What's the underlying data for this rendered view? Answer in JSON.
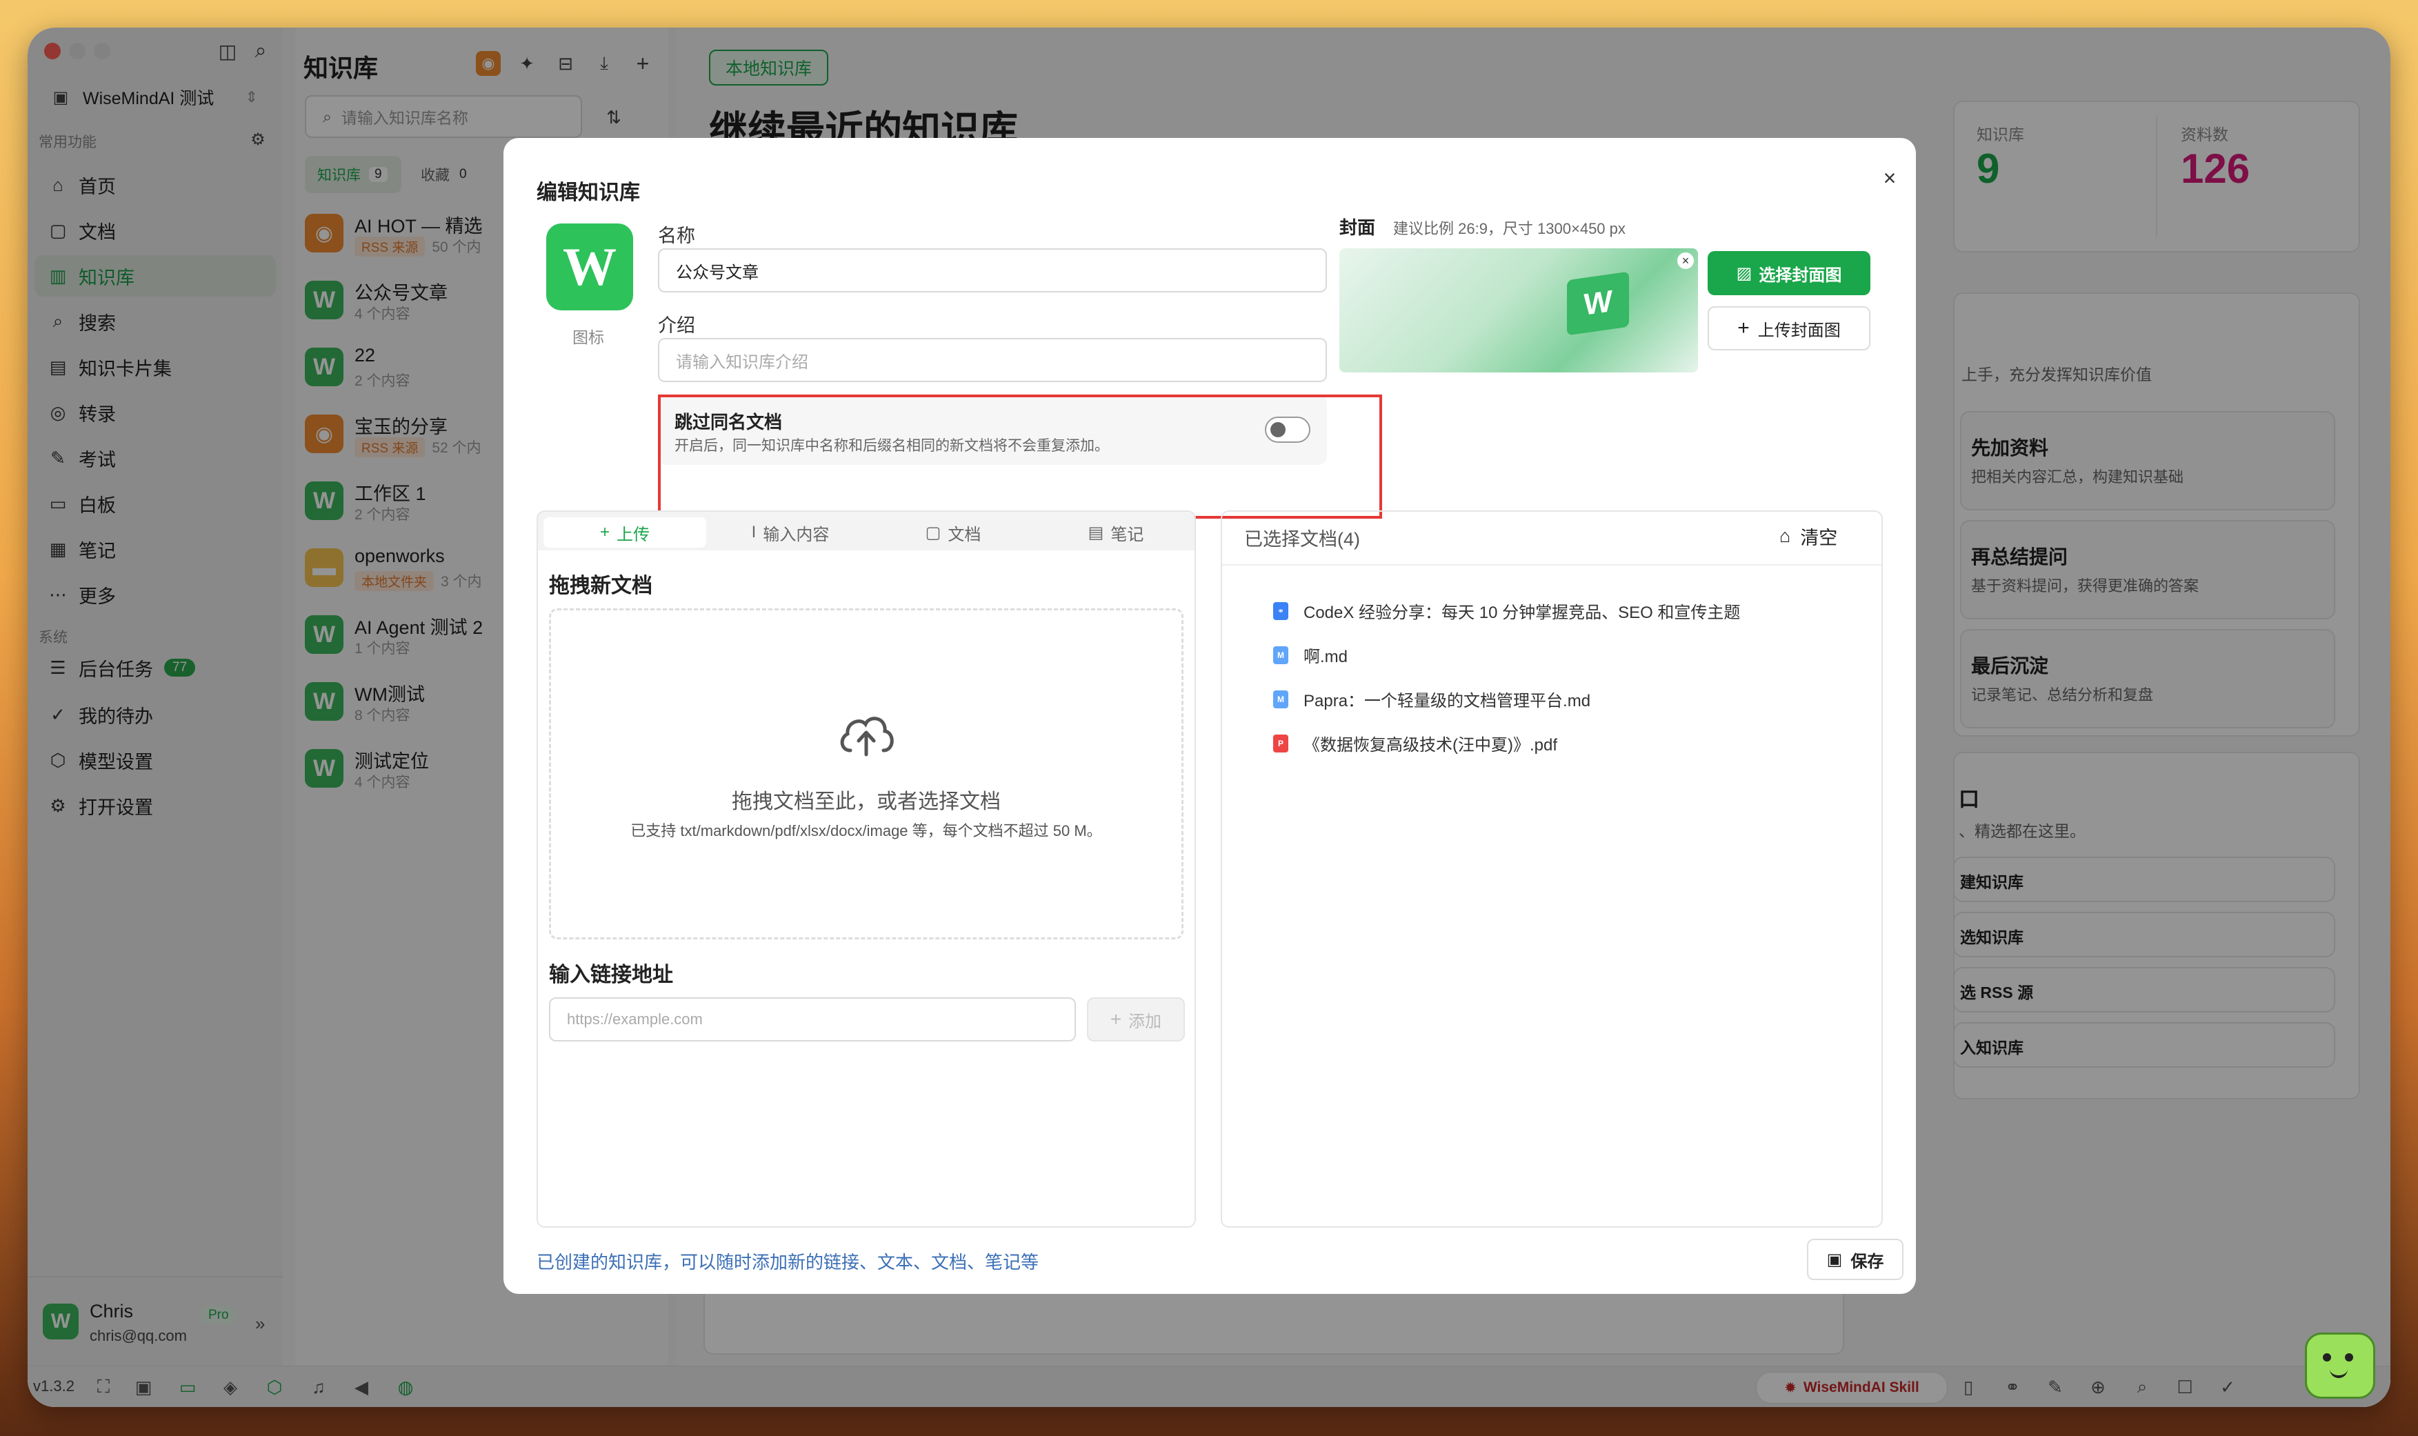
{
  "colors": {
    "accent": "#1aa64a",
    "rss": "#f08a30",
    "highlight": "#e53935",
    "number_pink": "#d81b7a"
  },
  "sidebar": {
    "workspace": "WiseMindAI 测试",
    "section_common": "常用功能",
    "items": [
      {
        "label": "首页",
        "icon": "home-icon",
        "glyph": "⌂"
      },
      {
        "label": "文档",
        "icon": "document-icon",
        "glyph": "▢"
      },
      {
        "label": "知识库",
        "icon": "book-icon",
        "glyph": "▥"
      },
      {
        "label": "搜索",
        "icon": "search-icon",
        "glyph": "⌕"
      },
      {
        "label": "知识卡片集",
        "icon": "cards-icon",
        "glyph": "▤"
      },
      {
        "label": "转录",
        "icon": "transcribe-icon",
        "glyph": "◎"
      },
      {
        "label": "考试",
        "icon": "exam-icon",
        "glyph": "✎"
      },
      {
        "label": "白板",
        "icon": "whiteboard-icon",
        "glyph": "▭"
      },
      {
        "label": "笔记",
        "icon": "notes-icon",
        "glyph": "▦"
      },
      {
        "label": "更多",
        "icon": "more-icon",
        "glyph": "⋯"
      }
    ],
    "section_system": "系统",
    "system_items": [
      {
        "label": "后台任务",
        "icon": "tasks-icon",
        "glyph": "☰",
        "badge": "77"
      },
      {
        "label": "我的待办",
        "icon": "check-circle-icon",
        "glyph": "✓"
      },
      {
        "label": "模型设置",
        "icon": "model-icon",
        "glyph": "⬡"
      },
      {
        "label": "打开设置",
        "icon": "gear-icon",
        "glyph": "⚙"
      }
    ],
    "user": {
      "name": "Chris",
      "email": "chris@qq.com",
      "plan": "Pro"
    }
  },
  "list": {
    "title": "知识库",
    "search_placeholder": "请输入知识库名称",
    "tab_kb": "知识库",
    "tab_kb_count": "9",
    "tab_fav": "收藏",
    "tab_fav_count": "0",
    "items": [
      {
        "name": "AI HOT — 精选",
        "tag": "RSS 来源",
        "sub": "50 个内",
        "logo": "rss"
      },
      {
        "name": "公众号文章",
        "tag": "",
        "sub": "4 个内容",
        "logo": "w"
      },
      {
        "name": "22",
        "tag": "",
        "sub": "2 个内容",
        "logo": "w"
      },
      {
        "name": "宝玉的分享",
        "tag": "RSS 来源",
        "sub": "52 个内",
        "logo": "rss"
      },
      {
        "name": "工作区 1",
        "tag": "",
        "sub": "2 个内容",
        "logo": "w"
      },
      {
        "name": "openworks",
        "tag": "本地文件夹",
        "sub": "3 个内",
        "logo": "folder"
      },
      {
        "name": "AI Agent 测试 2",
        "tag": "",
        "sub": "1 个内容",
        "logo": "w"
      },
      {
        "name": "WM测试",
        "tag": "",
        "sub": "8 个内容",
        "logo": "w"
      },
      {
        "name": "测试定位",
        "tag": "",
        "sub": "4 个内容",
        "logo": "w"
      }
    ]
  },
  "main": {
    "badge": "本地知识库",
    "heading": "继续最近的知识库",
    "stats": [
      {
        "label": "知识库",
        "value": "9"
      },
      {
        "label": "资料数",
        "value": "126"
      }
    ],
    "guide_sub": "上手，充分发挥知识库价值",
    "guide": [
      {
        "title": "先加资料",
        "desc": "把相关内容汇总，构建知识基础"
      },
      {
        "title": "再总结提问",
        "desc": "基于资料提问，获得更准确的答案"
      },
      {
        "title": "最后沉淀",
        "desc": "记录笔记、总结分析和复盘"
      }
    ],
    "entry_title": "口",
    "entry_sub": "、精选都在这里。",
    "entry_items": [
      "建知识库",
      "选知识库",
      "选 RSS 源",
      "入知识库"
    ]
  },
  "modal": {
    "title": "编辑知识库",
    "icon_label": "图标",
    "name_label": "名称",
    "name_value": "公众号文章",
    "intro_label": "介绍",
    "intro_placeholder": "请输入知识库介绍",
    "cover_label": "封面",
    "cover_hint": "建议比例 26:9，尺寸 1300×450 px",
    "choose_cover": "选择封面图",
    "upload_cover": "上传封面图",
    "skip_title": "跳过同名文档",
    "skip_desc": "开启后，同一知识库中名称和后缀名相同的新文档将不会重复添加。",
    "skip_enabled": false,
    "tabs": [
      "上传",
      "输入内容",
      "文档",
      "笔记"
    ],
    "drag_title": "拖拽新文档",
    "drop_main": "拖拽文档至此，或者选择文档",
    "drop_sub": "已支持 txt/markdown/pdf/xlsx/docx/image 等，每个文档不超过 50 M。",
    "link_title": "输入链接地址",
    "link_placeholder": "https://example.com",
    "add_label": "添加",
    "selected_title": "已选择文档(4)",
    "clear_label": "清空",
    "files": [
      {
        "name": "CodeX 经验分享：每天 10 分钟掌握竞品、SEO 和宣传主题",
        "type": "link"
      },
      {
        "name": "啊.md",
        "type": "md"
      },
      {
        "name": "Papra：一个轻量级的文档管理平台.md",
        "type": "md"
      },
      {
        "name": "《数据恢复高级技术(汪中夏)》.pdf",
        "type": "pdf"
      }
    ],
    "footer_note": "已创建的知识库，可以随时添加新的链接、文本、文档、笔记等",
    "save_label": "保存"
  },
  "bottombar": {
    "version": "v1.3.2",
    "skill_label": "WiseMindAI Skill"
  }
}
